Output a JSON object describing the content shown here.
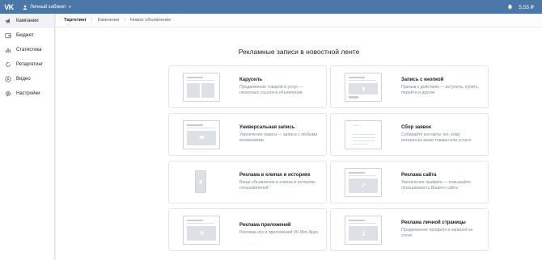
{
  "header": {
    "logo": "VK",
    "cabinet_label": "Личный кабинет",
    "balance": "5,55 ₽"
  },
  "sidebar": {
    "items": [
      {
        "label": "Кампании",
        "icon": "megaphone-icon",
        "active": true
      },
      {
        "label": "Бюджет",
        "icon": "wallet-icon",
        "active": false
      },
      {
        "label": "Статистика",
        "icon": "bar-chart-icon",
        "active": false
      },
      {
        "label": "Ретаргетинг",
        "icon": "retarget-icon",
        "active": false
      },
      {
        "label": "Видео",
        "icon": "video-icon",
        "active": false
      },
      {
        "label": "Настройки",
        "icon": "gear-icon",
        "active": false
      }
    ]
  },
  "breadcrumb": {
    "items": [
      "Таргетинг",
      "Кампании",
      "Новое объявление"
    ]
  },
  "main": {
    "heading": "Рекламные записи в новостной ленте",
    "cards": [
      {
        "title": "Карусель",
        "desc": "Продвижение товаров и услуг — несколько ссылок в объявлении"
      },
      {
        "title": "Запись с кнопкой",
        "desc": "Призыв к действию — вступить, купить, перейти и другие"
      },
      {
        "title": "Универсальная запись",
        "desc": "Увеличение охвата — записи с любыми вложениями"
      },
      {
        "title": "Сбор заявок",
        "desc": "Собирайте контакты тех, кому интересны ваши товары или услуги"
      },
      {
        "title": "Реклама в клипах и историях",
        "desc": "Ваши объявление в клипах и историях пользователей"
      },
      {
        "title": "Реклама сайта",
        "desc": "Увеличение трафика — повышайте посещаемость Вашего сайта"
      },
      {
        "title": "Реклама приложений",
        "desc": "Реклама игр и приложений VK Mini Apps"
      },
      {
        "title": "Реклама личной страницы",
        "desc": "Продвижение профиля и записей на стене"
      }
    ]
  },
  "colors": {
    "header_bg": "#4a76a8",
    "page_bg": "#edeef0",
    "card_border": "#e3e5e8",
    "muted_text": "#818c99"
  }
}
